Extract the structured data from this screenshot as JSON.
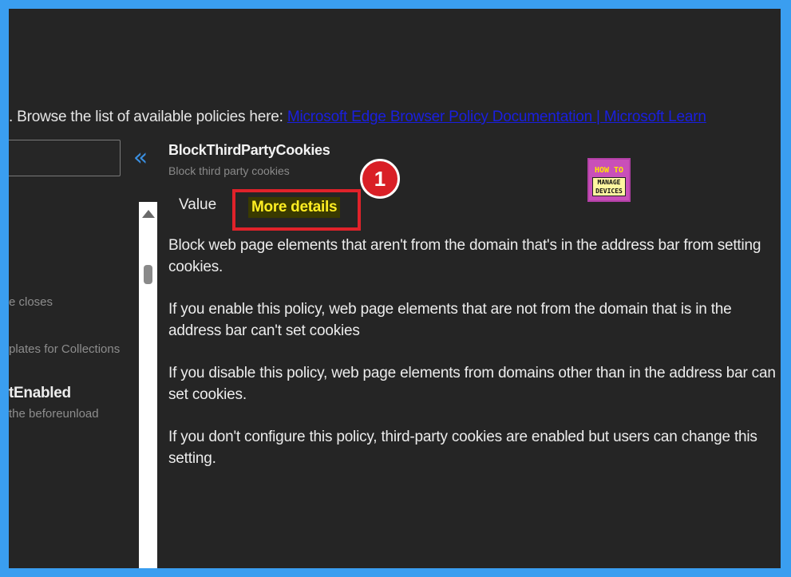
{
  "header": {
    "browse_text": ". Browse the list of available policies here: ",
    "link_text": "Microsoft Edge Browser Policy Documentation | Microsoft Learn"
  },
  "sidebar": {
    "search_value": "",
    "collapse_glyph": "«",
    "items": [
      {
        "label": "e closes"
      },
      {
        "label": "plates for Collections"
      },
      {
        "label": "tEnabled"
      },
      {
        "label": "the beforeunload"
      }
    ]
  },
  "policy": {
    "title": "BlockThirdPartyCookies",
    "subtitle": "Block third party cookies"
  },
  "tabs": [
    {
      "label": "Value"
    },
    {
      "label": "More details"
    }
  ],
  "annotation": {
    "step_number": "1"
  },
  "logo": {
    "line1": "HOW TO",
    "line2": "MANAGE",
    "line3": "DEVICES"
  },
  "details": [
    "Block web page elements that aren't from the domain that's in the address bar from setting cookies.",
    "If you enable this policy, web page elements that are not from the domain that is in the address bar can't set cookies",
    "If you disable this policy, web page elements from domains other than in the address bar can set cookies.",
    "If you don't configure this policy, third-party cookies are enabled but users can change this setting."
  ],
  "colors": {
    "frame_border": "#3a9ef0",
    "background": "#252525",
    "highlight_text": "#ffee22",
    "annotation_red": "#e0222a",
    "link": "#1a1fe0"
  }
}
